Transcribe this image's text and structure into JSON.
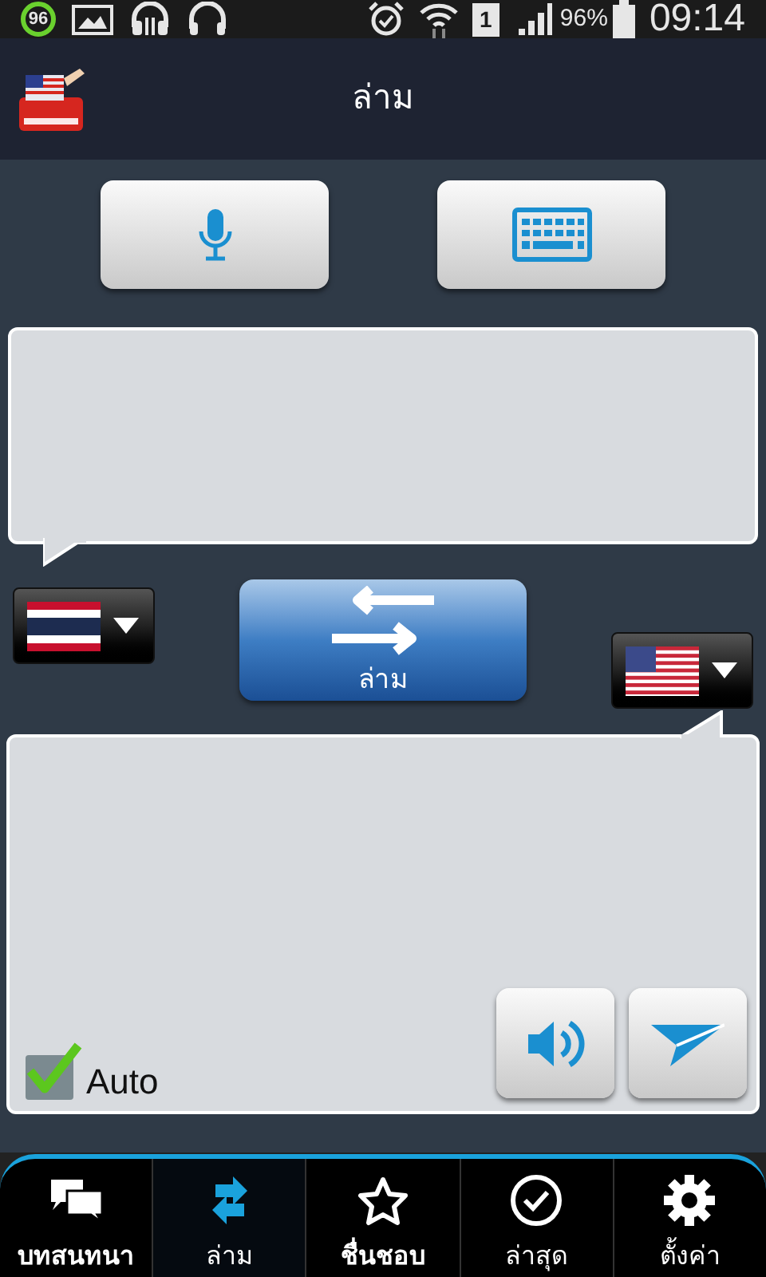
{
  "status_bar": {
    "badge": "96",
    "sim": "1",
    "battery": "96%",
    "time": "09:14"
  },
  "header": {
    "title": "ล่าม"
  },
  "input_modes": [
    {
      "kind": "mic"
    },
    {
      "kind": "keyboard"
    }
  ],
  "source_language": {
    "kind": "th"
  },
  "swap_button": {
    "label": "ล่าม"
  },
  "target_language": {
    "kind": "us"
  },
  "output": {
    "auto": {
      "label": "Auto",
      "checked": true
    },
    "actions": [
      {
        "kind": "speaker"
      },
      {
        "kind": "send"
      }
    ]
  },
  "tabs": [
    {
      "label": "บทสนทนา",
      "kind": "chat",
      "selected": false,
      "bold": true
    },
    {
      "label": "ล่าม",
      "kind": "swap",
      "selected": true,
      "bold": false
    },
    {
      "label": "ชื่นชอบ",
      "kind": "star",
      "selected": false,
      "bold": true
    },
    {
      "label": "ล่าสุด",
      "kind": "check",
      "selected": false,
      "bold": false
    },
    {
      "label": "ตั้งค่า",
      "kind": "gear",
      "selected": false,
      "bold": false
    }
  ]
}
